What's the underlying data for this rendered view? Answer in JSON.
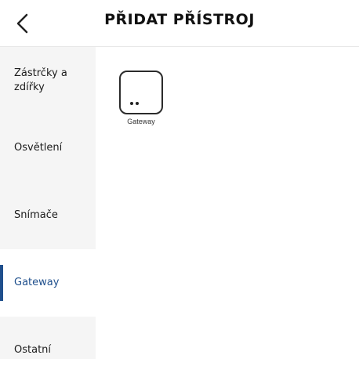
{
  "header": {
    "title": "PŘIDAT PŘÍSTROJ",
    "back_icon": "chevron-left-icon"
  },
  "sidebar": {
    "items": [
      {
        "label": "Zástrčky a zdířky",
        "active": false
      },
      {
        "label": "Osvětlení",
        "active": false
      },
      {
        "label": "Snímače",
        "active": false
      },
      {
        "label": "Gateway",
        "active": true
      },
      {
        "label": "Ostatní",
        "active": false
      }
    ]
  },
  "content": {
    "devices": [
      {
        "label": "Gateway",
        "icon": "gateway-device-icon"
      }
    ]
  },
  "colors": {
    "accent": "#1f4f8c",
    "sidebar_bg": "#f5f5f5"
  }
}
